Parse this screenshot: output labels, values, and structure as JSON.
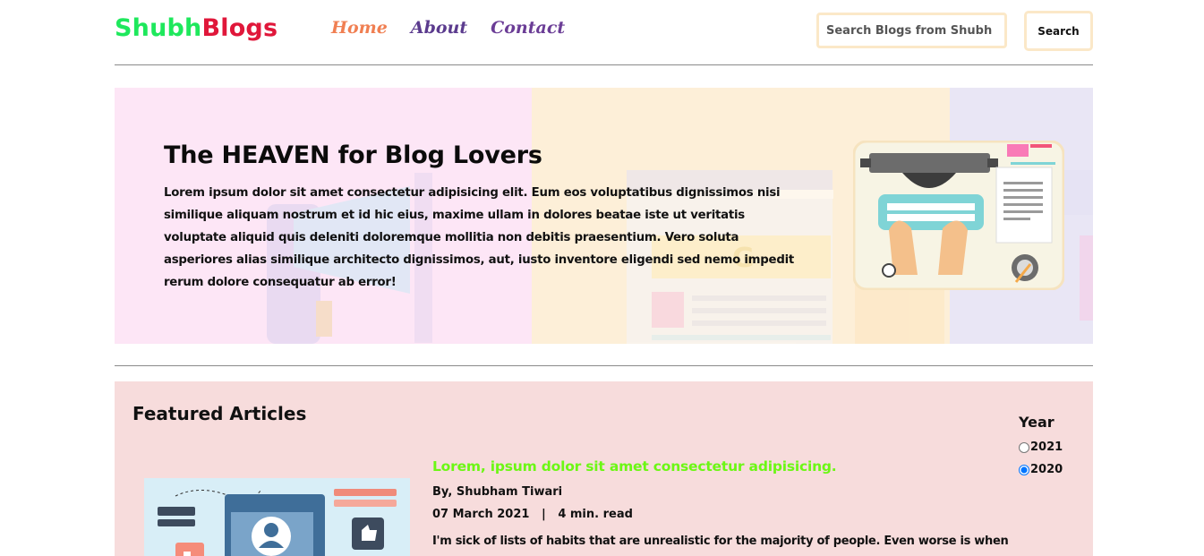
{
  "brand": {
    "part1": "Shubh",
    "part2": "Blogs",
    "color1": "#1ee85c",
    "color2": "#e0173a"
  },
  "nav": {
    "items": [
      {
        "label": "Home",
        "color": "#f07f52"
      },
      {
        "label": "About",
        "color": "#5b3b8e"
      },
      {
        "label": "Contact",
        "color": "#6b3d96"
      }
    ]
  },
  "search": {
    "placeholder": "Search Blogs from Shubh",
    "button_label": "Search"
  },
  "hero": {
    "title": "The HEAVEN for Blog Lovers",
    "body": "Lorem ipsum dolor sit amet consectetur adipisicing elit. Eum eos voluptatibus dignissimos nisi similique aliquam nostrum et id hic eius, maxime ullam in dolores beatae iste ut veritatis voluptate aliquid quis deleniti doloremque mollitia non debitis praesentium. Vero soluta asperiores alias similique architecto dignissimos, aut, iusto inventore eligendi sed nemo impedit rerum dolore consequatur ab error!",
    "illustration_icon": "typewriter-illustration"
  },
  "featured": {
    "heading": "Featured Articles",
    "article": {
      "title": "Lorem, ipsum dolor sit amet consectetur adipisicing.",
      "author": "By, Shubham Tiwari",
      "date": "07 March 2021",
      "separator": "|",
      "read_time": "4 min. read",
      "excerpt": "I'm sick of lists of habits that are unrealistic for the majority of people. Even worse is when",
      "title_color": "#6cf714",
      "thumbnail_icon": "profile-webpage-illustration"
    },
    "filter": {
      "label": "Year",
      "options": [
        {
          "label": "2021",
          "selected": false
        },
        {
          "label": "2020",
          "selected": true
        }
      ]
    }
  }
}
